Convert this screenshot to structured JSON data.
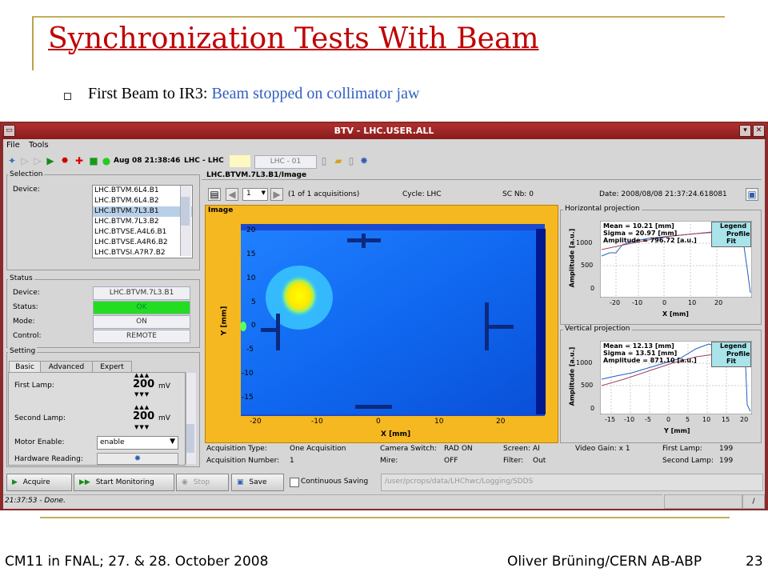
{
  "slide": {
    "title": "Synchronization Tests With Beam",
    "bullet_lead": "First Beam to IR3: ",
    "bullet_highlight": "Beam stopped on collimator jaw",
    "footer_left": "CM11 in FNAL; 27. & 28. October 2008",
    "footer_right": "Oliver Brüning/CERN AB-ABP",
    "page_number": "23"
  },
  "colors": {
    "title_red": "#c00000",
    "highlight_blue": "#2f5fc0",
    "status_ok_green": "#22dd22",
    "window_title_red": "#8a1c1c",
    "image_frame_orange": "#f5b820"
  },
  "window": {
    "title": "BTV - LHC.USER.ALL",
    "menu": [
      "File",
      "Tools"
    ],
    "toolbar": {
      "timestamp": "Aug 08 21:38:46",
      "context": "LHC - LHC",
      "user": "LHC - 01"
    }
  },
  "selection": {
    "title": "Selection",
    "device_label": "Device:",
    "devices": [
      "LHC.BTVM.6L4.B1",
      "LHC.BTVM.6L4.B2",
      "LHC.BTVM.7L3.B1",
      "LHC.BTVM.7L3.B2",
      "LHC.BTVSE.A4L6.B1",
      "LHC.BTVSE.A4R6.B2",
      "LHC.BTVSI.A7R7.B2"
    ],
    "selected_index": 2
  },
  "status": {
    "title": "Status",
    "device_label": "Device:",
    "device_value": "LHC.BTVM.7L3.B1",
    "status_label": "Status:",
    "status_value": "OK",
    "mode_label": "Mode:",
    "mode_value": "ON",
    "control_label": "Control:",
    "control_value": "REMOTE"
  },
  "setting": {
    "title": "Setting",
    "tabs": [
      "Basic",
      "Advanced",
      "Expert"
    ],
    "first_lamp_label": "First Lamp:",
    "first_lamp_value": "200",
    "second_lamp_label": "Second Lamp:",
    "second_lamp_value": "200",
    "unit": "mV",
    "motor_label": "Motor Enable:",
    "motor_value": "enable",
    "hw_label": "Hardware Reading:"
  },
  "image_panel": {
    "title": "LHC.BTVM.7L3.B1/Image",
    "nav_value": "1",
    "acq_count": "(1 of 1 acquisitions)",
    "cycle": "Cycle: LHC",
    "sc_nb": "SC Nb: 0",
    "date": "Date:  2008/08/08 21:37:24.618081",
    "image_label": "Image",
    "x_ticks": [
      "-20",
      "-10",
      "0",
      "10",
      "20"
    ],
    "y_ticks": [
      "20",
      "15",
      "10",
      "5",
      "0",
      "-5",
      "-10",
      "-15"
    ],
    "x_axis": "X [mm]",
    "y_axis": "Y [mm]"
  },
  "hproj": {
    "title": "Horizontal projection",
    "stats": [
      "Mean = 10.21 [mm]",
      "Sigma = 20.97 [mm]",
      "Amplitude = 796.72 [a.u.]"
    ],
    "legend_title": "Legend",
    "legend": [
      "Profile",
      "Fit"
    ],
    "y_label": "Amplitude [a.u.]",
    "y_ticks": [
      "1000",
      "500",
      "0"
    ],
    "x_ticks": [
      "-20",
      "-10",
      "0",
      "10",
      "20"
    ],
    "x_label": "X [mm]"
  },
  "vproj": {
    "title": "Vertical projection",
    "stats": [
      "Mean = 12.13 [mm]",
      "Sigma = 13.51 [mm]",
      "Amplitude = 871.10 [a.u.]"
    ],
    "legend_title": "Legend",
    "legend": [
      "Profile",
      "Fit"
    ],
    "y_label": "Amplitude [a.u.]",
    "y_ticks": [
      "1000",
      "500",
      "0"
    ],
    "x_ticks": [
      "-15",
      "-10",
      "-5",
      "0",
      "5",
      "10",
      "15",
      "20"
    ],
    "x_label": "Y [mm]"
  },
  "info": {
    "acq_type_label": "Acquisition Type:",
    "acq_type_value": "One Acquisition",
    "acq_num_label": "Acquisition Number:",
    "acq_num_value": "1",
    "camera_switch_label": "Camera Switch:",
    "camera_switch_value": "RAD ON",
    "mire_label": "Mire:",
    "mire_value": "OFF",
    "screen_label": "Screen:",
    "screen_value": "AI",
    "filter_label": "Filter:",
    "filter_value": "Out",
    "video_gain": "Video Gain: x 1",
    "first_lamp_label": "First Lamp:",
    "first_lamp_value": "199",
    "second_lamp_label": "Second Lamp:",
    "second_lamp_value": "199"
  },
  "buttons": {
    "acquire": "Acquire",
    "start_monitoring": "Start Monitoring",
    "stop": "Stop",
    "save": "Save",
    "continuous_saving": "Continuous Saving",
    "path": "/user/pcrops/data/LHChwc/Logging/SDDS"
  },
  "statusbar": {
    "message": "21:37:53 - Done."
  }
}
